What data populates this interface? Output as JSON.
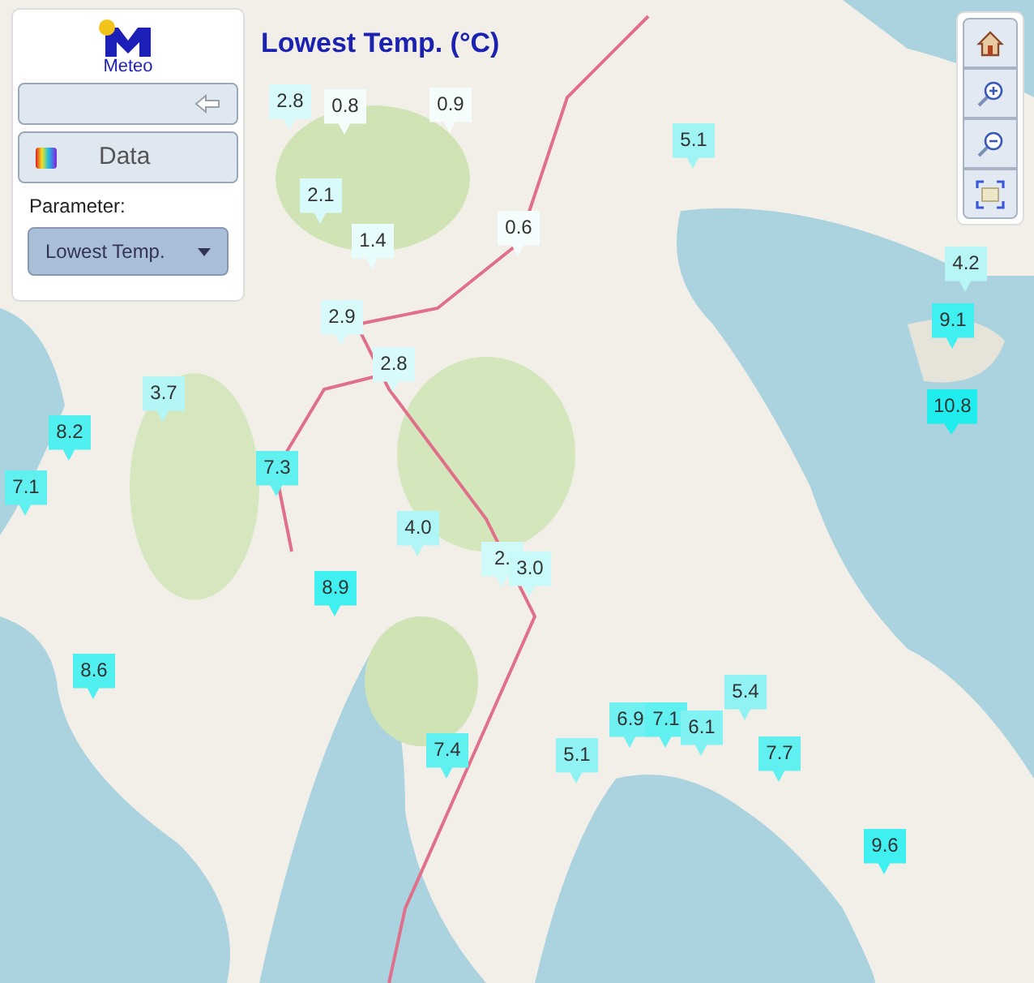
{
  "title": "Lowest Temp. (°C)",
  "panel": {
    "logo_text": "Meteo",
    "data_button": "Data",
    "parameter_label": "Parameter:",
    "parameter_select": {
      "value": "Lowest Temp."
    }
  },
  "map_controls": [
    {
      "kind": "home"
    },
    {
      "kind": "zoom_in"
    },
    {
      "kind": "zoom_out"
    },
    {
      "kind": "extent"
    }
  ],
  "markers": [
    {
      "text": "2.8",
      "color": "#d8fafa"
    },
    {
      "text": "0.8",
      "color": "#f4fcfc"
    },
    {
      "text": "0.9",
      "color": "#f4fcfc"
    },
    {
      "text": "5.1",
      "color": "#a0f4f4"
    },
    {
      "text": "2.1",
      "color": "#d8fafa"
    },
    {
      "text": "1.4",
      "color": "#e8fcfc"
    },
    {
      "text": "0.6",
      "color": "#f4fcfc"
    },
    {
      "text": "4.2",
      "color": "#b8f6f6"
    },
    {
      "text": "2.9",
      "color": "#d8fafa"
    },
    {
      "text": "9.1",
      "color": "#40f0f0"
    },
    {
      "text": "2.8",
      "color": "#d8fafa"
    },
    {
      "text": "3.7",
      "color": "#b4f6f6"
    },
    {
      "text": "8.2",
      "color": "#50f0f0"
    },
    {
      "text": "10.8",
      "color": "#20eeee"
    },
    {
      "text": "7.1",
      "color": "#60f0f0"
    },
    {
      "text": "7.3",
      "color": "#60f0f0"
    },
    {
      "text": "4.0",
      "color": "#b0f6f6"
    },
    {
      "text": "2.",
      "color": "#d0fafa"
    },
    {
      "text": "3.0",
      "color": "#c8fafa"
    },
    {
      "text": "8.9",
      "color": "#40f0f0"
    },
    {
      "text": "8.6",
      "color": "#50f0f0"
    },
    {
      "text": "5.4",
      "color": "#90f2f2"
    },
    {
      "text": "6.9",
      "color": "#70f0f0"
    },
    {
      "text": "7.1",
      "color": "#60f0f0"
    },
    {
      "text": "6.1",
      "color": "#80f2f2"
    },
    {
      "text": "7.4",
      "color": "#60f0f0"
    },
    {
      "text": "5.1",
      "color": "#90f2f2"
    },
    {
      "text": "7.7",
      "color": "#60f0f0"
    },
    {
      "text": "9.6",
      "color": "#40f0f0"
    }
  ]
}
